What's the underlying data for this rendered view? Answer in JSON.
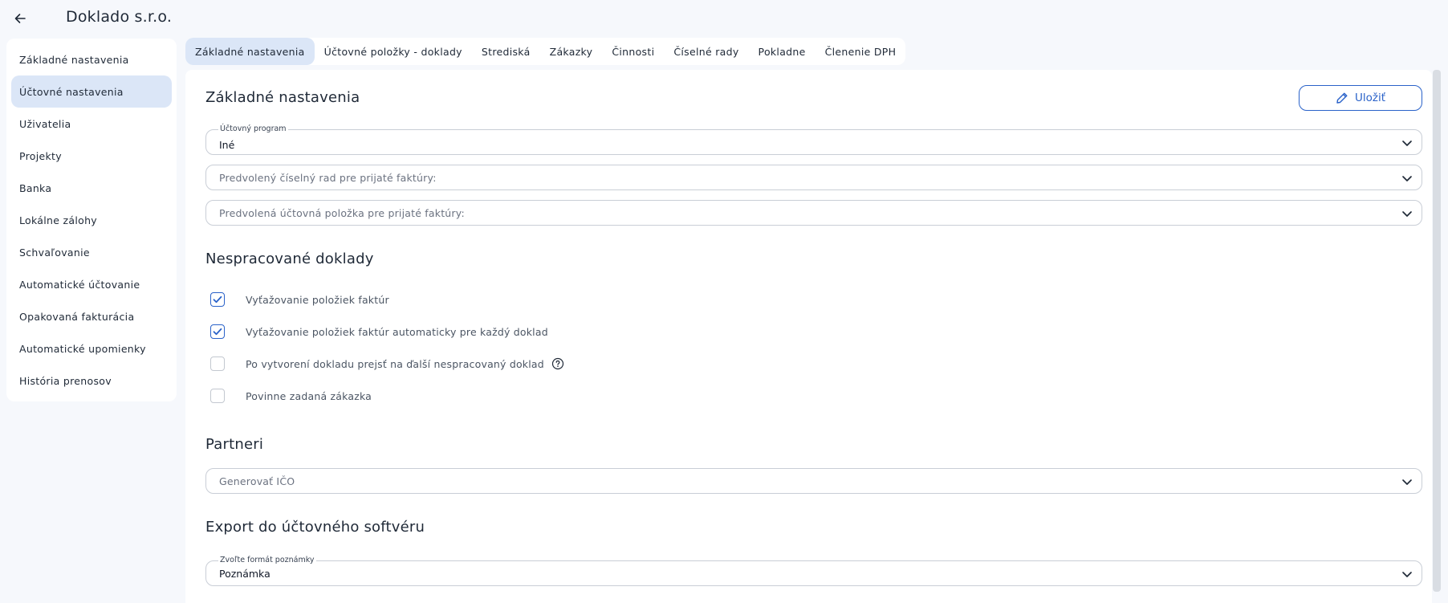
{
  "header": {
    "back_icon": "arrow-left-icon",
    "title": "Doklado s.r.o."
  },
  "sidebar": {
    "items": [
      {
        "label": "Základné nastavenia",
        "active": false
      },
      {
        "label": "Účtovné nastavenia",
        "active": true
      },
      {
        "label": "Uživatelia",
        "active": false
      },
      {
        "label": "Projekty",
        "active": false
      },
      {
        "label": "Banka",
        "active": false
      },
      {
        "label": "Lokálne zálohy",
        "active": false
      },
      {
        "label": "Schvaľovanie",
        "active": false
      },
      {
        "label": "Automatické účtovanie",
        "active": false
      },
      {
        "label": "Opakovaná fakturácia",
        "active": false
      },
      {
        "label": "Automatické upomienky",
        "active": false
      },
      {
        "label": "História prenosov",
        "active": false
      }
    ]
  },
  "tabs": [
    {
      "label": "Základné nastavenia",
      "active": true
    },
    {
      "label": "Účtovné položky - doklady",
      "active": false
    },
    {
      "label": "Strediská",
      "active": false
    },
    {
      "label": "Zákazky",
      "active": false
    },
    {
      "label": "Činnosti",
      "active": false
    },
    {
      "label": "Číselné rady",
      "active": false
    },
    {
      "label": "Pokladne",
      "active": false
    },
    {
      "label": "Členenie DPH",
      "active": false
    }
  ],
  "main": {
    "section_basic": "Základné nastavenia",
    "save_label": "Uložiť",
    "save_icon": "pencil-icon",
    "accounting_program": {
      "label": "Účtovný program",
      "value": "Iné"
    },
    "default_series_placeholder": "Predvolený číselný rad pre prijaté faktúry:",
    "default_item_placeholder": "Predvolená účtovná položka pre prijaté faktúry:",
    "section_unprocessed": "Nespracované doklady",
    "checkboxes": [
      {
        "label": "Vyťažovanie položiek faktúr",
        "checked": true
      },
      {
        "label": "Vyťažovanie položiek faktúr automaticky pre každý doklad",
        "checked": true
      },
      {
        "label": "Po vytvorení dokladu prejsť na ďalší nespracovaný doklad",
        "checked": false,
        "help_icon": "help-circle-icon"
      },
      {
        "label": "Povinne zadaná zákazka",
        "checked": false
      }
    ],
    "section_partners": "Partneri",
    "partners_placeholder": "Generovať IČO",
    "section_export": "Export do účtovného softvéru",
    "note_format": {
      "label": "Zvoľte formát poznámky",
      "value": "Poznámka"
    }
  },
  "colors": {
    "accent": "#2a62c9",
    "active_bg": "#dbe6f7",
    "page_bg": "#f6f8fc"
  }
}
